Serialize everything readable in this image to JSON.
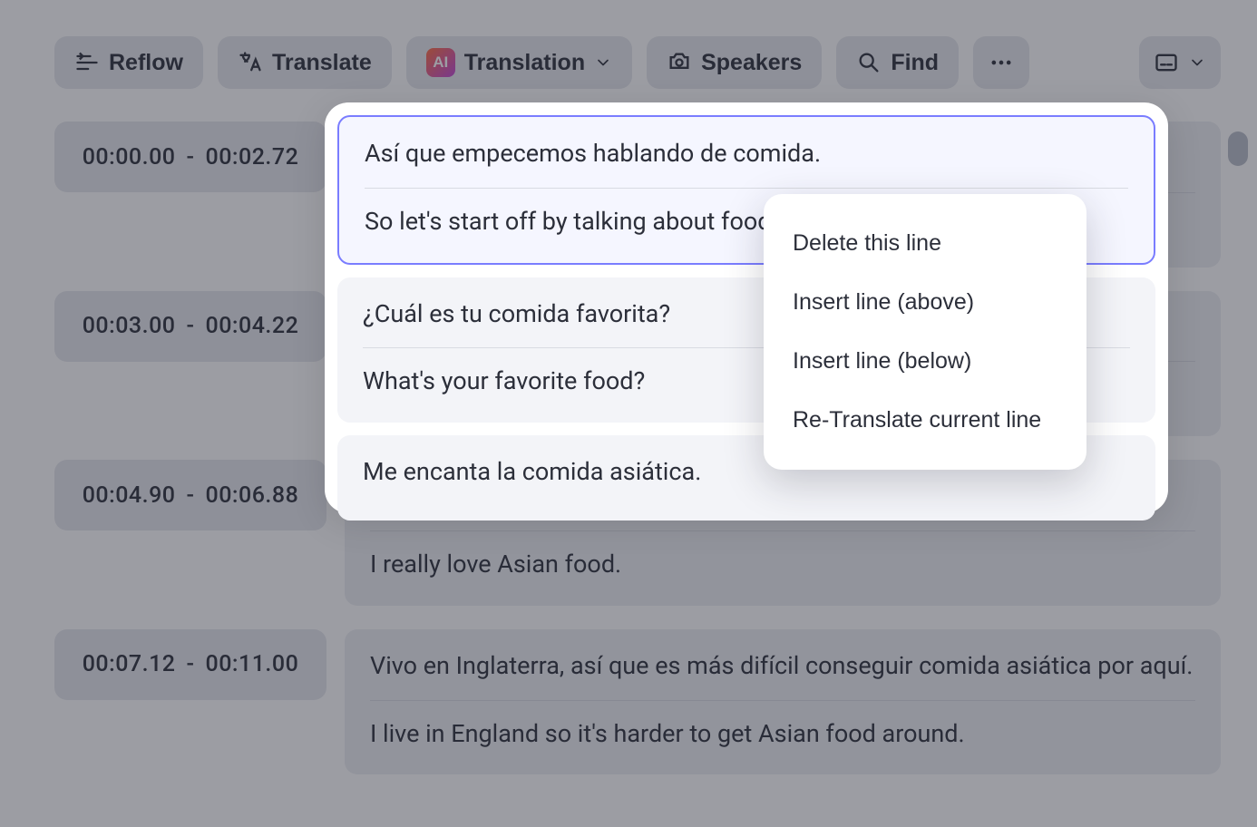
{
  "toolbar": {
    "reflow": "Reflow",
    "translate": "Translate",
    "translation": "Translation",
    "speakers": "Speakers",
    "find": "Find",
    "ai_badge": "AI"
  },
  "segments": [
    {
      "start": "00:00.00",
      "end": "00:02.72",
      "src": "Así que empecemos hablando de comida.",
      "tgt": "So let's start off by talking about food."
    },
    {
      "start": "00:03.00",
      "end": "00:04.22",
      "src": "¿Cuál es tu comida favorita?",
      "tgt": "What's your favorite food?"
    },
    {
      "start": "00:04.90",
      "end": "00:06.88",
      "src": "Me encanta la comida asiática.",
      "tgt": "I really love Asian food."
    },
    {
      "start": "00:07.12",
      "end": "00:11.00",
      "src": "Vivo en Inglaterra, así que es más difícil conseguir comida asiática por aquí.",
      "tgt": "I live in England so it's harder to get Asian food around."
    }
  ],
  "context_menu": {
    "delete": "Delete this line",
    "insert_above": "Insert line (above)",
    "insert_below": "Insert line (below)",
    "retranslate": "Re-Translate current line"
  }
}
